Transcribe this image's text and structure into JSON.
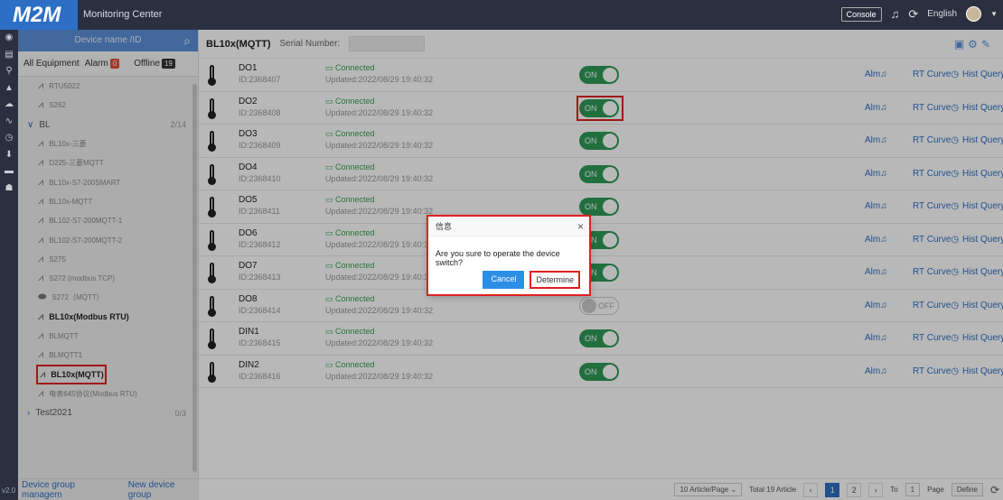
{
  "app": {
    "logo": "M2M",
    "title": "Monitoring Center",
    "version": "v2.0"
  },
  "topbar": {
    "console": "Console",
    "language": "English",
    "bell_icon": "bell-icon",
    "refresh_icon": "refresh-icon"
  },
  "rail": {
    "icons": [
      "home-icon",
      "save-icon",
      "location-icon",
      "bell-icon",
      "cloud-icon",
      "chart-icon",
      "clock-icon",
      "download-icon",
      "folder-icon",
      "user-icon"
    ]
  },
  "sidebar": {
    "search_placeholder": "Device name /ID",
    "filters": {
      "all": "All Equipment",
      "alarm": "Alarm",
      "alarm_count": "0",
      "offline": "Offline",
      "offline_count": "19"
    },
    "tree": [
      {
        "label": "RTU5022",
        "type": "device"
      },
      {
        "label": "S262",
        "type": "device"
      },
      {
        "label": "BL",
        "type": "group",
        "count": "2/14"
      },
      {
        "label": "BL10x-三菱",
        "type": "device"
      },
      {
        "label": "D225-三菱MQTT",
        "type": "device"
      },
      {
        "label": "BL10x-S7-200SMART",
        "type": "device"
      },
      {
        "label": "BL10x-MQTT",
        "type": "device"
      },
      {
        "label": "BL102-S7-200MQTT-1",
        "type": "device"
      },
      {
        "label": "BL102-S7-200MQTT-2",
        "type": "device"
      },
      {
        "label": "S275",
        "type": "device"
      },
      {
        "label": "S272 (modbus TCP)",
        "type": "device"
      },
      {
        "label": "S272（MQTT）",
        "type": "device"
      },
      {
        "label": "BL10x(Modbus RTU)",
        "type": "device-bold"
      },
      {
        "label": "BLMQTT",
        "type": "device"
      },
      {
        "label": "BLMQTT1",
        "type": "device"
      },
      {
        "label": "BL10x(MQTT)",
        "type": "device-selected"
      },
      {
        "label": "电表645协议(Modbus RTU)",
        "type": "device"
      },
      {
        "label": "Test2021",
        "type": "group",
        "count": "0/3"
      }
    ],
    "bottom": {
      "manage": "Device group managem",
      "new_group": "New device group"
    }
  },
  "main": {
    "device_title": "BL10x(MQTT)",
    "serial_label": "Serial Number:",
    "rows": [
      {
        "name": "DO1",
        "id": "ID:2368407",
        "status": "Connected",
        "updated": "Updated:2022/08/29 19:40:32",
        "switch": "ON"
      },
      {
        "name": "DO2",
        "id": "ID:2368408",
        "status": "Connected",
        "updated": "Updated:2022/08/29 19:40:32",
        "switch": "ON"
      },
      {
        "name": "DO3",
        "id": "ID:2368409",
        "status": "Connected",
        "updated": "Updated:2022/08/29 19:40:32",
        "switch": "ON"
      },
      {
        "name": "DO4",
        "id": "ID:2368410",
        "status": "Connected",
        "updated": "Updated:2022/08/29 19:40:32",
        "switch": "ON"
      },
      {
        "name": "DO5",
        "id": "ID:2368411",
        "status": "Connected",
        "updated": "Updated:2022/08/29 19:40:32",
        "switch": "ON"
      },
      {
        "name": "DO6",
        "id": "ID:2368412",
        "status": "Connected",
        "updated": "Updated:2022/08/29 19:40:32",
        "switch": "ON"
      },
      {
        "name": "DO7",
        "id": "ID:2368413",
        "status": "Connected",
        "updated": "Updated:2022/08/29 19:40:32",
        "switch": "ON"
      },
      {
        "name": "DO8",
        "id": "ID:2368414",
        "status": "Connected",
        "updated": "Updated:2022/08/29 19:40:32",
        "switch": "OFF"
      },
      {
        "name": "DIN1",
        "id": "ID:2368415",
        "status": "Connected",
        "updated": "Updated:2022/08/29 19:40:32",
        "switch": "ON"
      },
      {
        "name": "DIN2",
        "id": "ID:2368416",
        "status": "Connected",
        "updated": "Updated:2022/08/29 19:40:32",
        "switch": "ON"
      }
    ],
    "actions": {
      "alarm": "Alm",
      "rt_curve": "RT Curve",
      "hist": "Hist Query"
    },
    "pager": {
      "per_page": "10 Article/Page",
      "total": "Total 19 Article",
      "pages": [
        "1",
        "2"
      ],
      "current": "1",
      "to": "To",
      "page_input": "1",
      "page": "Page",
      "define": "Define"
    }
  },
  "dialog": {
    "title": "信息",
    "message": "Are you sure to operate the device switch?",
    "cancel": "Cancel",
    "confirm": "Determine"
  },
  "colors": {
    "topbar": "#2a3040",
    "accent": "#2d6fc4",
    "switch_on": "#2e9a57",
    "connected": "#3aa04e",
    "highlight": "#e02020"
  }
}
